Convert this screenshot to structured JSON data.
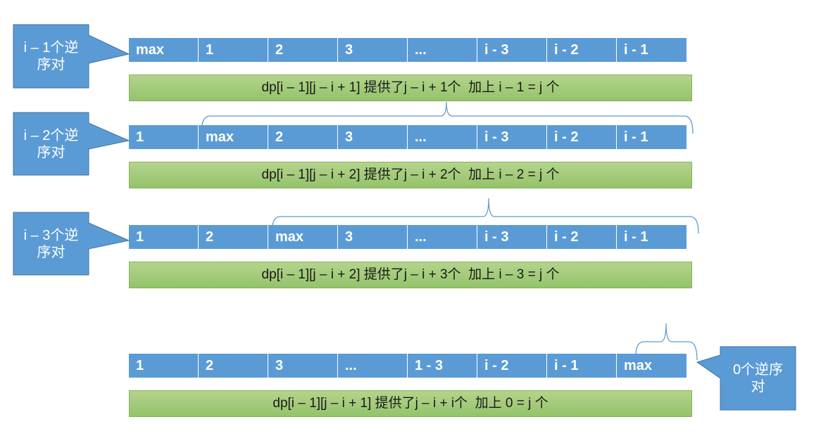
{
  "colors": {
    "cell_blue": "#5b9bd5",
    "callout_blue": "#5b9bd5",
    "green_bar": "#9bc76f",
    "brace": "#5b9bd5"
  },
  "blocks": [
    {
      "callout": "i – 1个逆\n序对",
      "cells": [
        "max",
        "1",
        "2",
        "3",
        "...",
        "i - 3",
        "i - 2",
        "i - 1"
      ],
      "formula": "dp[i – 1][j – i + 1] 提供了j – i + 1个  加上 i – 1 = j 个"
    },
    {
      "callout": "i – 2个逆\n序对",
      "cells": [
        "1",
        "max",
        "2",
        "3",
        "...",
        "i - 3",
        "i - 2",
        "i - 1"
      ],
      "formula": "dp[i – 1][j – i + 2] 提供了j – i + 2个  加上 i – 2 = j 个"
    },
    {
      "callout": "i – 3个逆\n序对",
      "cells": [
        "1",
        "2",
        "max",
        "3",
        "...",
        "i - 3",
        "i - 2",
        "i - 1"
      ],
      "formula": "dp[i – 1][j – i + 2] 提供了j – i + 3个  加上 i – 3 = j 个"
    },
    {
      "callout": "0个逆序\n对",
      "cells": [
        "1",
        "2",
        "3",
        "...",
        "1 - 3",
        "i - 2",
        "i - 1",
        "max"
      ],
      "formula": "dp[i – 1][j – i + 1] 提供了j – i + i个  加上 0 = j 个"
    }
  ]
}
